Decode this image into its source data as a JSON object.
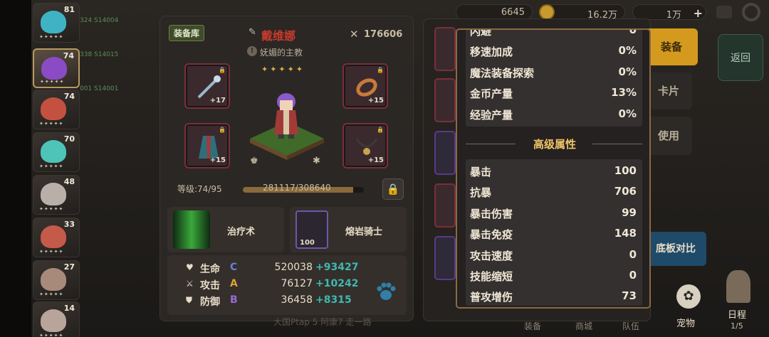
{
  "roster": {
    "items": [
      {
        "level": "81",
        "stars": "✦✦✦✦✦",
        "color": "#3fb3c4"
      },
      {
        "level": "74",
        "stars": "✦✦✦✦✦",
        "color": "#8a4bc4"
      },
      {
        "level": "74",
        "stars": "✦✦✦✦✦",
        "color": "#c4503f"
      },
      {
        "level": "70",
        "stars": "✦✦✦✦✦",
        "color": "#4ec4b8"
      },
      {
        "level": "48",
        "stars": "✦✦✦✦✦",
        "color": "#b8b0a8"
      },
      {
        "level": "33",
        "stars": "✦✦✦✦✦",
        "color": "#c45a4a"
      },
      {
        "level": "27",
        "stars": "✦✦✦✦✦",
        "color": "#a88a7a"
      },
      {
        "level": "14",
        "stars": "✦✦✦✦✦",
        "color": "#b8a49a"
      }
    ]
  },
  "background_text": {
    "line1": "324  S14004",
    "line2": "338  S14015",
    "line3": "001  S14001"
  },
  "top_bar": {
    "gold": "6645",
    "gems": "16.2万",
    "energy": "1万",
    "plus": "+"
  },
  "hero": {
    "inventory_tag": "装备库",
    "name": "戴维娜",
    "subtitle": "妩媚的主教",
    "power": "176606",
    "stars": "✦✦✦✦✦",
    "level_label": "等级:74/95",
    "exp_text": "281117/308640",
    "exp_fraction": 0.91,
    "equipment": [
      {
        "bonus": "+17",
        "icon": "staff-icon"
      },
      {
        "bonus": "+15",
        "icon": "bracelet-icon"
      },
      {
        "bonus": "+15",
        "icon": "robe-icon"
      },
      {
        "bonus": "+15",
        "icon": "necklace-icon"
      }
    ],
    "skill_name": "治疗术",
    "pet_name": "熔岩骑士",
    "pet_count": "100",
    "stats": [
      {
        "icon": "♥",
        "name": "生命",
        "grade": "C",
        "grade_color": "#6a7fd8",
        "value": "520038",
        "bonus": "+93427"
      },
      {
        "icon": "⚔",
        "name": "攻击",
        "grade": "A",
        "grade_color": "#d8a23a",
        "value": "76127",
        "bonus": "+10242"
      },
      {
        "icon": "⛊",
        "name": "防御",
        "grade": "B",
        "grade_color": "#9a6ad8",
        "value": "36458",
        "bonus": "+8315"
      }
    ]
  },
  "right_menu": {
    "equip": "装备",
    "cards": "卡片",
    "use": "使用",
    "compare": "底板对比",
    "back": "返回",
    "pet": "宠物",
    "schedule": "日程",
    "schedule_count": "1/5"
  },
  "detail_popup": {
    "basic_rows": [
      {
        "name": "闪避",
        "value": "0"
      },
      {
        "name": "移速加成",
        "value": "0%"
      },
      {
        "name": "魔法装备探索",
        "value": "0%"
      },
      {
        "name": "金币产量",
        "value": "13%"
      },
      {
        "name": "经验产量",
        "value": "0%"
      }
    ],
    "advanced_title": "高级属性",
    "advanced_rows": [
      {
        "name": "暴击",
        "value": "100"
      },
      {
        "name": "抗暴",
        "value": "706"
      },
      {
        "name": "暴击伤害",
        "value": "99"
      },
      {
        "name": "暴击免疫",
        "value": "148"
      },
      {
        "name": "攻击速度",
        "value": "0"
      },
      {
        "name": "技能缩短",
        "value": "0"
      },
      {
        "name": "普攻增伤",
        "value": "73"
      }
    ]
  },
  "bottom_tabs": {
    "tab1": "装备",
    "tab2": "商城",
    "tab3": "队伍",
    "chat": "大国Ptap 5 阿康7 走一路"
  }
}
